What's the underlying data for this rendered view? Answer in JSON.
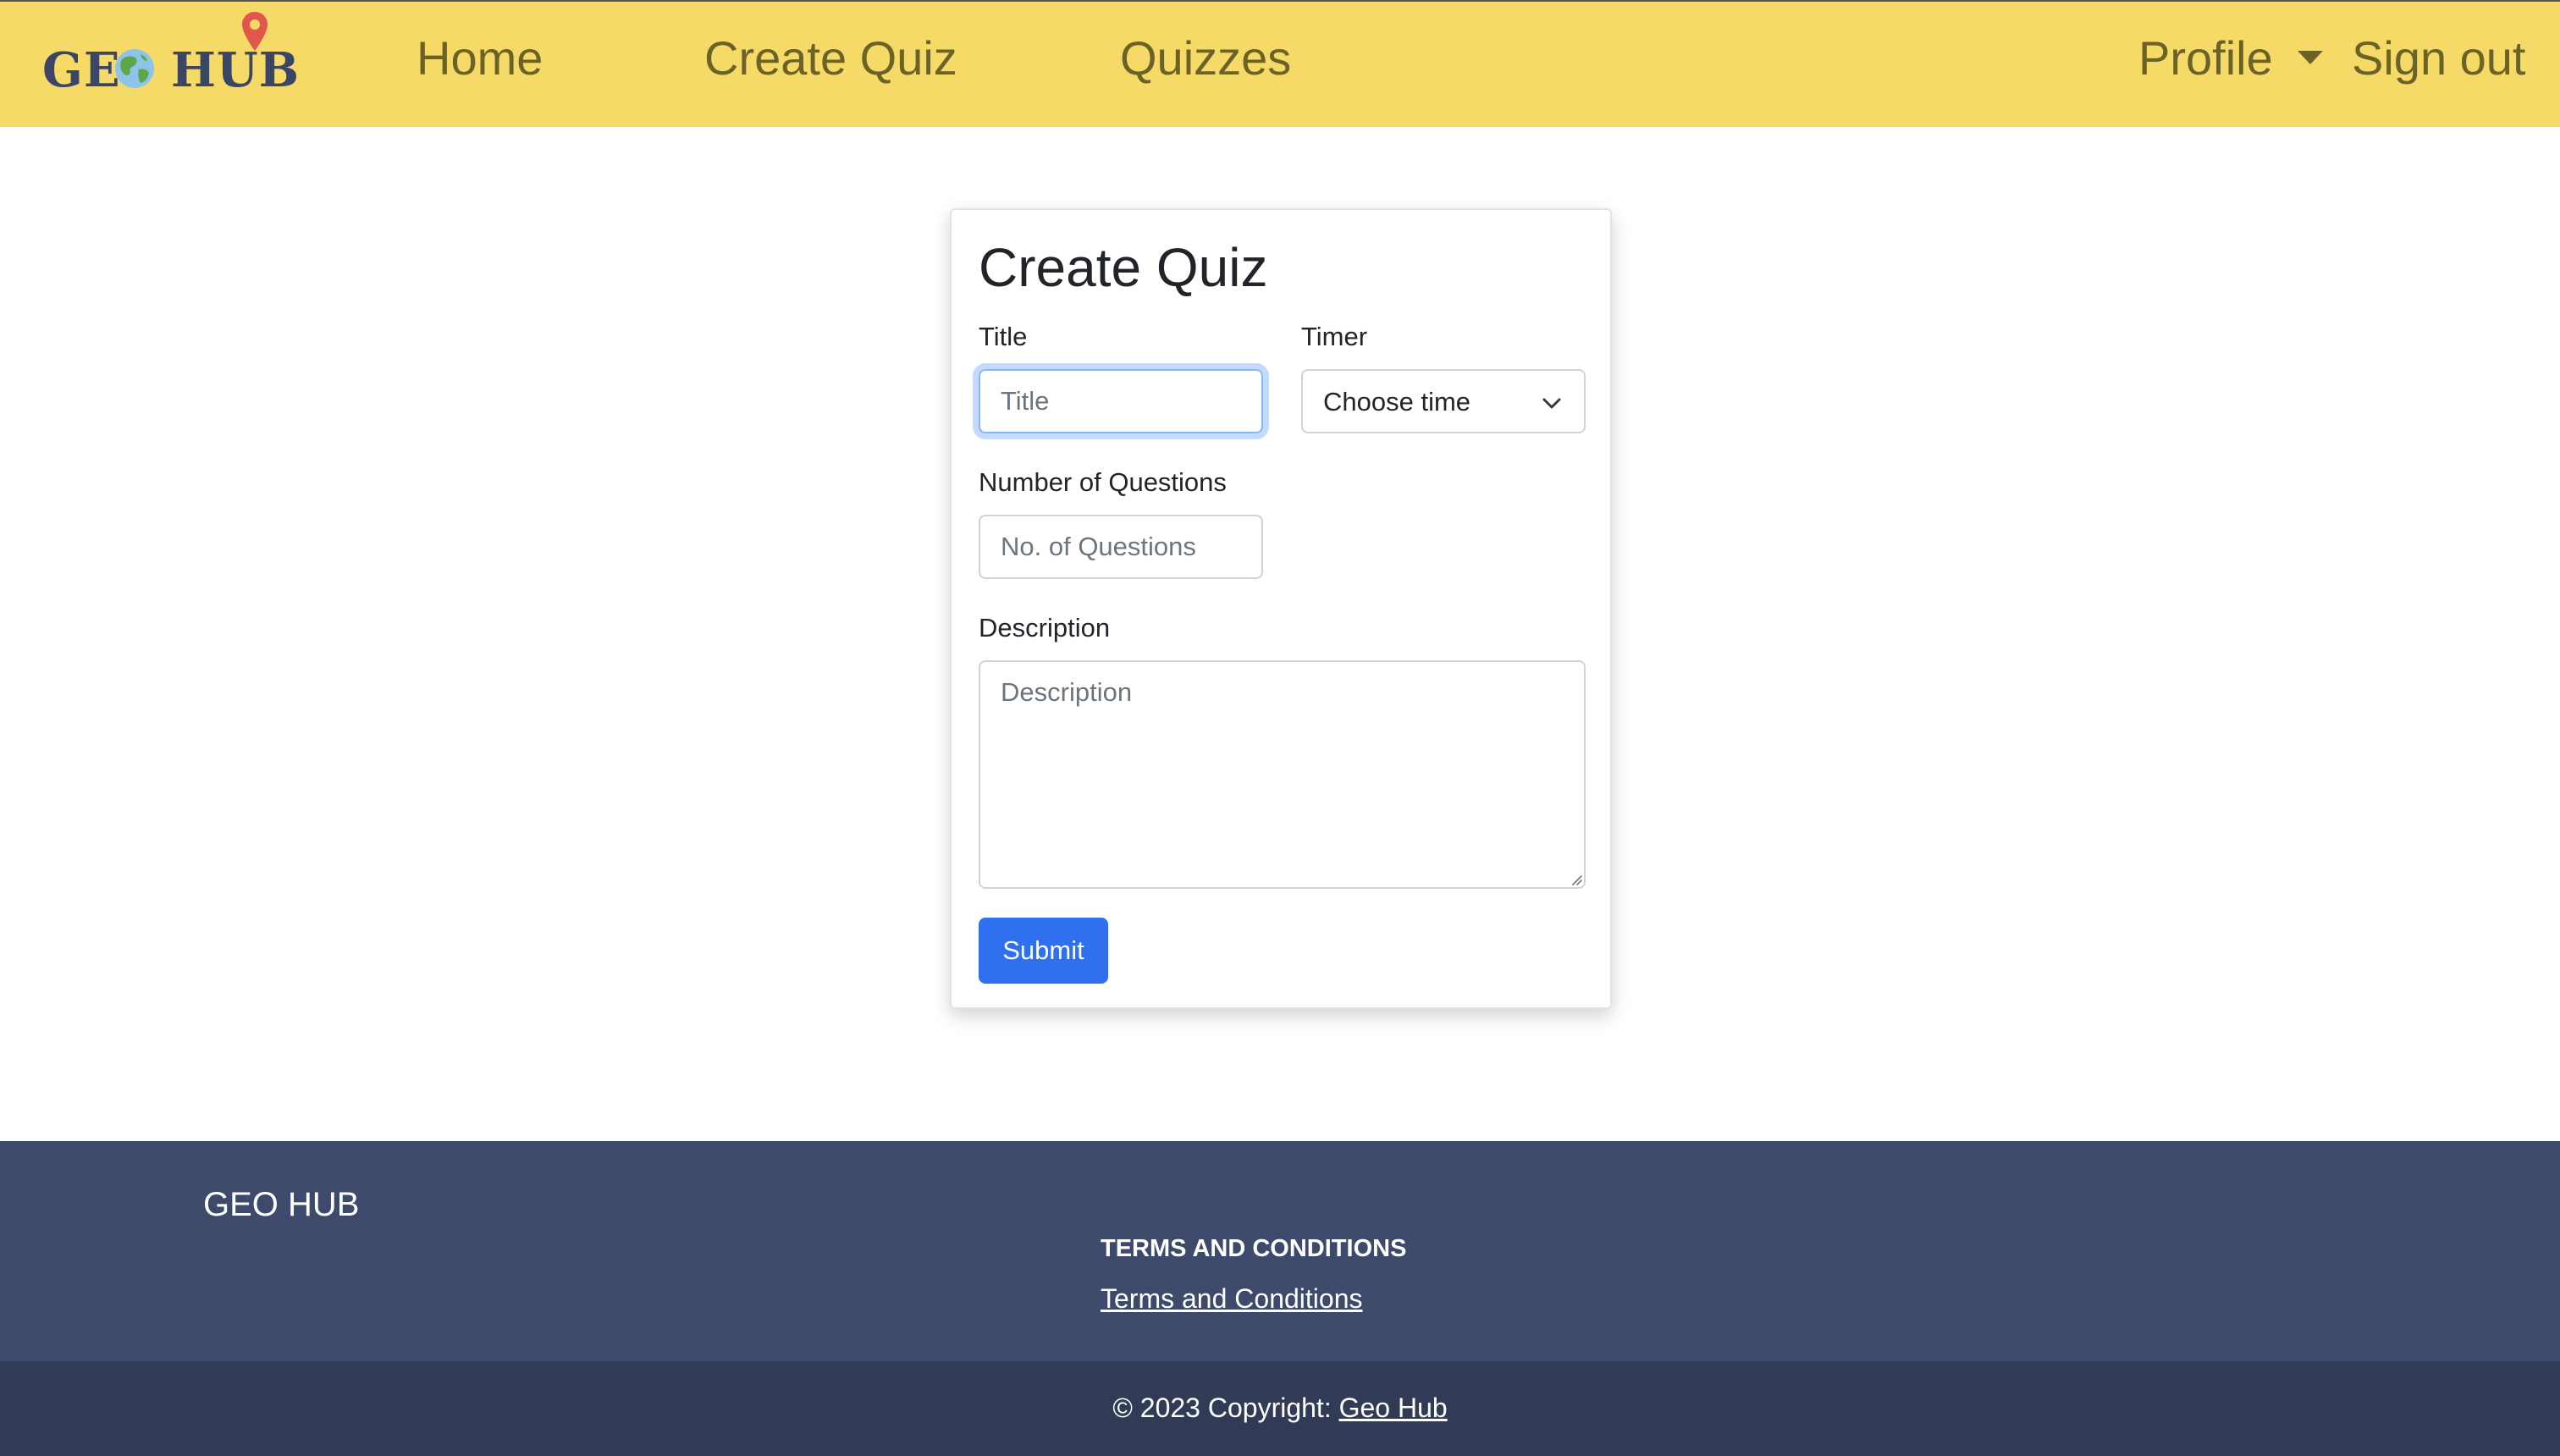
{
  "colors": {
    "navbar_bg": "#f5da67",
    "nav_text": "#6b6228",
    "primary_button": "#2f6ff0",
    "footer_bg": "#3e4a6b",
    "copyright_bg": "#323b55",
    "logo_text": "#3b4565",
    "pin": "#e2574c"
  },
  "navbar": {
    "logo": {
      "text_left": "GE",
      "text_right": "HUB",
      "globe_icon": "globe-icon",
      "pin_icon": "map-pin-icon"
    },
    "links": {
      "home": "Home",
      "create_quiz": "Create Quiz",
      "quizzes": "Quizzes"
    },
    "profile": "Profile",
    "profile_caret_icon": "caret-down-icon",
    "sign_out": "Sign out"
  },
  "form": {
    "heading": "Create Quiz",
    "title_label": "Title",
    "title_placeholder": "Title",
    "title_value": "",
    "timer_label": "Timer",
    "timer_selected": "Choose time",
    "timer_chevron_icon": "chevron-down-icon",
    "num_questions_label": "Number of Questions",
    "num_questions_placeholder": "No. of Questions",
    "num_questions_value": "",
    "description_label": "Description",
    "description_placeholder": "Description",
    "description_value": "",
    "submit_label": "Submit"
  },
  "footer": {
    "brand": "GEO HUB",
    "terms_heading": "TERMS AND CONDITIONS",
    "terms_link": "Terms and Conditions",
    "copyright_prefix": "© 2023 Copyright: ",
    "copyright_link": "Geo Hub"
  }
}
